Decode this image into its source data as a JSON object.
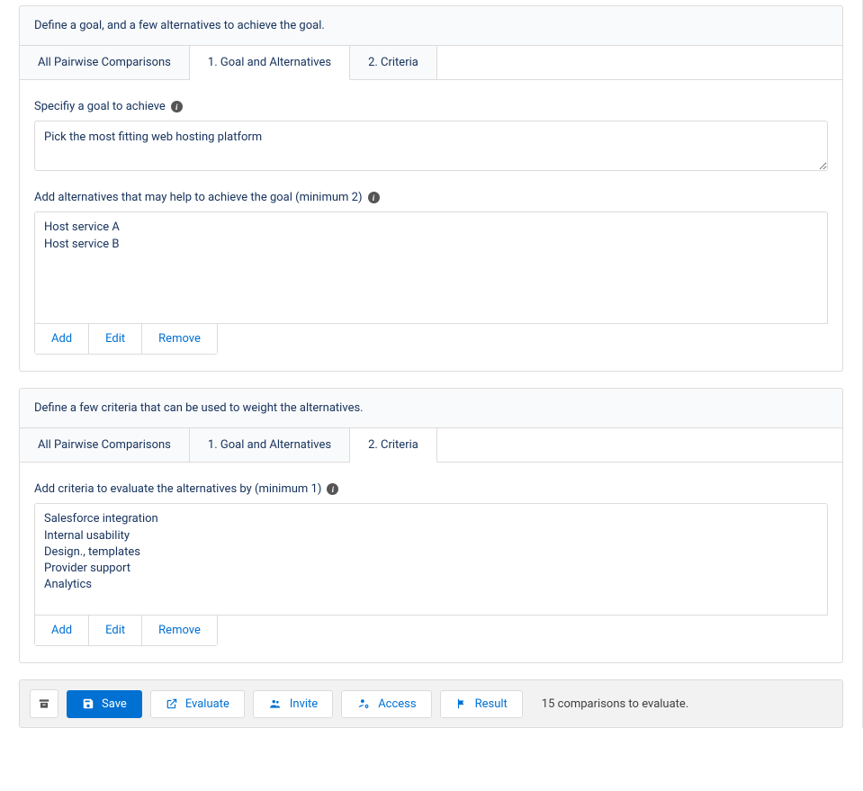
{
  "section1": {
    "header": "Define a goal, and a few alternatives to achieve the goal.",
    "tabs": {
      "all": "All Pairwise Comparisons",
      "goal": "1. Goal and Alternatives",
      "criteria": "2. Criteria"
    },
    "goal_label": "Specifiy a goal to achieve",
    "goal_value": "Pick the most fitting web hosting platform",
    "alt_label": "Add alternatives that may help to achieve the goal (minimum 2)",
    "alternatives": [
      "Host service A",
      "Host service B"
    ],
    "buttons": {
      "add": "Add",
      "edit": "Edit",
      "remove": "Remove"
    }
  },
  "section2": {
    "header": "Define a few criteria that can be used to weight the alternatives.",
    "tabs": {
      "all": "All Pairwise Comparisons",
      "goal": "1. Goal and Alternatives",
      "criteria": "2. Criteria"
    },
    "criteria_label": "Add criteria to evaluate the alternatives by (minimum 1)",
    "criteria": [
      "Salesforce integration",
      "Internal usability",
      "Design., templates",
      "Provider support",
      "Analytics"
    ],
    "buttons": {
      "add": "Add",
      "edit": "Edit",
      "remove": "Remove"
    }
  },
  "footer": {
    "save": "Save",
    "evaluate": "Evaluate",
    "invite": "Invite",
    "access": "Access",
    "result": "Result",
    "status": "15 comparisons to evaluate."
  }
}
